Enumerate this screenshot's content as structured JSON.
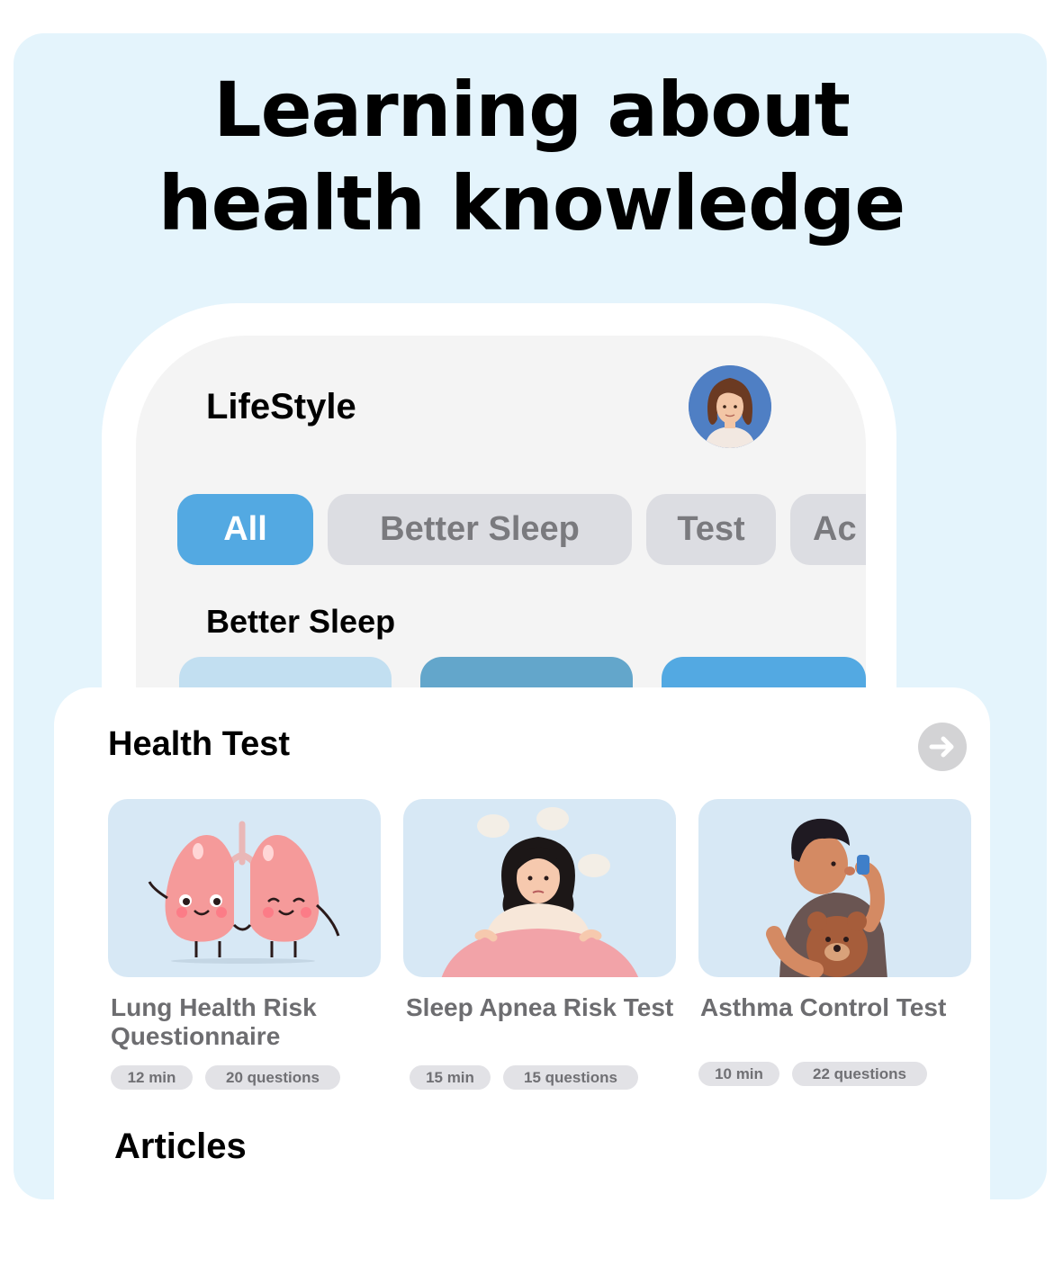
{
  "headline": {
    "line1": "Learning about",
    "line2": "health knowledge"
  },
  "app": {
    "title": "LifeStyle",
    "filters": [
      {
        "label": "All",
        "active": true
      },
      {
        "label": "Better Sleep",
        "active": false
      },
      {
        "label": "Test",
        "active": false
      },
      {
        "label": "Ac",
        "active": false
      }
    ],
    "better_sleep_title": "Better Sleep"
  },
  "health_test": {
    "title": "Health Test",
    "cards": [
      {
        "title": "Lung Health Risk Questionnaire",
        "duration": "12 min",
        "questions": "20 questions",
        "icon": "lungs-illustration"
      },
      {
        "title": "Sleep Apnea Risk Test",
        "duration": "15 min",
        "questions": "15 questions",
        "icon": "sleepless-woman-illustration"
      },
      {
        "title": "Asthma Control Test",
        "duration": "10 min",
        "questions": "22 questions",
        "icon": "boy-with-inhaler-illustration"
      }
    ]
  },
  "articles": {
    "title": "Articles"
  },
  "colors": {
    "panel_bg": "#e4f4fc",
    "accent": "#53a9e2",
    "chip_bg": "#dcdde2",
    "card_bg": "#d7e8f5"
  }
}
